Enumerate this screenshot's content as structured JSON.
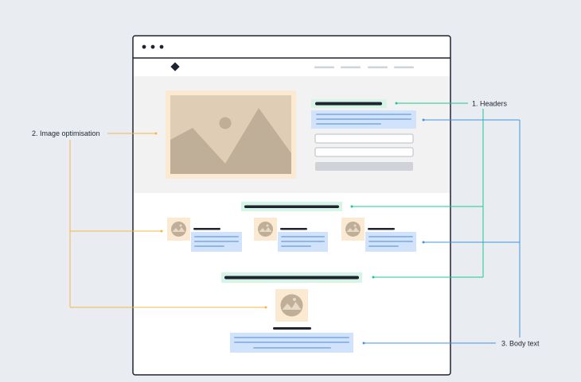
{
  "annotations": {
    "headers": "1. Headers",
    "image_optimisation": "2. Image optimisation",
    "body_text": "3. Body text"
  },
  "colors": {
    "background": "#e9ecf1",
    "headers": "#1fc88e",
    "image_optimisation": "#f3b84a",
    "body_text": "#3f96e6",
    "image_highlight": "#fce9d2",
    "header_highlight": "#d6f5e7",
    "text_highlight": "#d0e3fa",
    "hero_band": "#f2f2f2"
  },
  "browser_window": {
    "window_controls": [
      "dot",
      "dot",
      "dot"
    ],
    "nav_links_count": 4
  },
  "icons": {
    "logo": "diamond-logo-icon",
    "image_placeholder": "mountain-sun-image-icon"
  }
}
